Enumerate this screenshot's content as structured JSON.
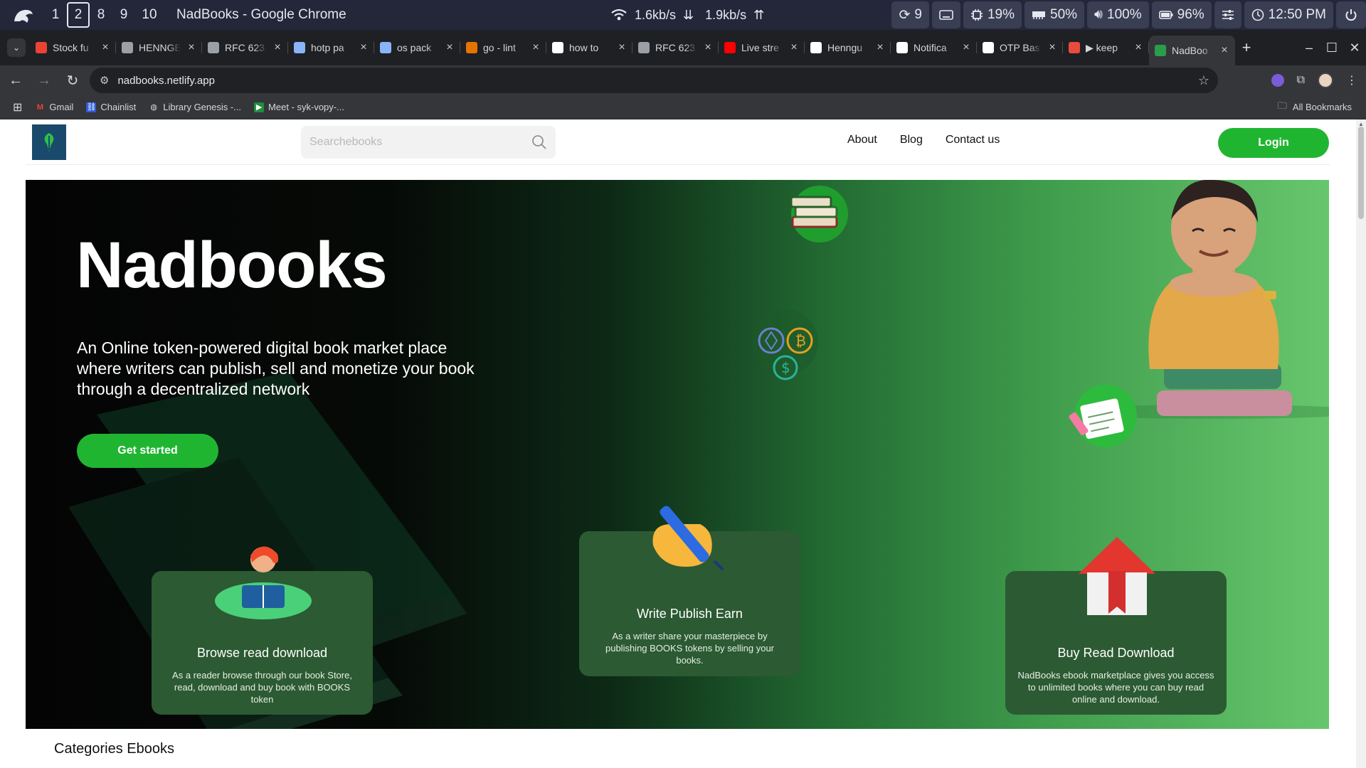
{
  "system_bar": {
    "workspaces": [
      "1",
      "2",
      "8",
      "9",
      "10"
    ],
    "active_workspace": "2",
    "window_title": "NadBooks - Google Chrome",
    "net_down": "1.6kb/s",
    "net_up": "1.9kb/s",
    "updates": "9",
    "cpu": "19%",
    "memory": "50%",
    "volume": "100%",
    "battery": "96%",
    "clock": "12:50 PM"
  },
  "tabs": [
    {
      "title": "Stock fu",
      "icon": "gmail-icon",
      "color": "#ea4335"
    },
    {
      "title": "HENNGE",
      "icon": "globe-icon",
      "color": "#9aa0a6"
    },
    {
      "title": "RFC 623",
      "icon": "rfc-icon",
      "color": "#9aa0a6"
    },
    {
      "title": "hotp pa",
      "icon": "doc-icon",
      "color": "#8ab4f8"
    },
    {
      "title": "os pack",
      "icon": "doc-icon",
      "color": "#8ab4f8"
    },
    {
      "title": "go - lint",
      "icon": "go-icon",
      "color": "#e37400"
    },
    {
      "title": "how to",
      "icon": "google-icon",
      "color": "#ffffff"
    },
    {
      "title": "RFC 623",
      "icon": "rfc-icon",
      "color": "#9aa0a6"
    },
    {
      "title": "Live stre",
      "icon": "youtube-icon",
      "color": "#ff0000"
    },
    {
      "title": "Henngu",
      "icon": "github-icon",
      "color": "#ffffff"
    },
    {
      "title": "Notifica",
      "icon": "github-icon",
      "color": "#ffffff"
    },
    {
      "title": "OTP Bas",
      "icon": "github-icon",
      "color": "#ffffff"
    },
    {
      "title": "▶ keep",
      "icon": "music-icon",
      "color": "#e94b3c"
    },
    {
      "title": "NadBoo",
      "icon": "nadbooks-icon",
      "color": "#2a9d4a"
    }
  ],
  "address_bar": {
    "url": "nadbooks.netlify.app"
  },
  "bookmarks": [
    {
      "label": "Gmail",
      "icon": "gmail-icon"
    },
    {
      "label": "Chainlist",
      "icon": "chainlist-icon"
    },
    {
      "label": "Library Genesis -...",
      "icon": "globe-icon"
    },
    {
      "label": "Meet - syk-vopy-...",
      "icon": "meet-icon"
    }
  ],
  "all_bookmarks": "All Bookmarks",
  "site": {
    "search_placeholder": "Searchebooks",
    "nav": [
      "About",
      "Blog",
      "Contact us"
    ],
    "login": "Login",
    "hero_title": "Nadbooks",
    "hero_subtitle": "An Online token-powered digital book market place where writers can publish, sell and monetize your book through a decentralized network",
    "cta": "Get started",
    "cards": [
      {
        "title": "Browse read download",
        "text": "As a reader browse through our book Store, read, download and buy book with BOOKS token"
      },
      {
        "title": "Write Publish Earn",
        "text": "As a writer share your masterpiece by publishing BOOKS tokens by selling your books."
      },
      {
        "title": "Buy Read Download",
        "text": "NadBooks ebook marketplace gives you access to unlimited books where you can buy read online and download."
      }
    ],
    "categories_heading": "Categories Ebooks"
  },
  "colors": {
    "brand_green": "#20b531",
    "card_green": "#2c5a33",
    "system_bar": "#24273a"
  }
}
